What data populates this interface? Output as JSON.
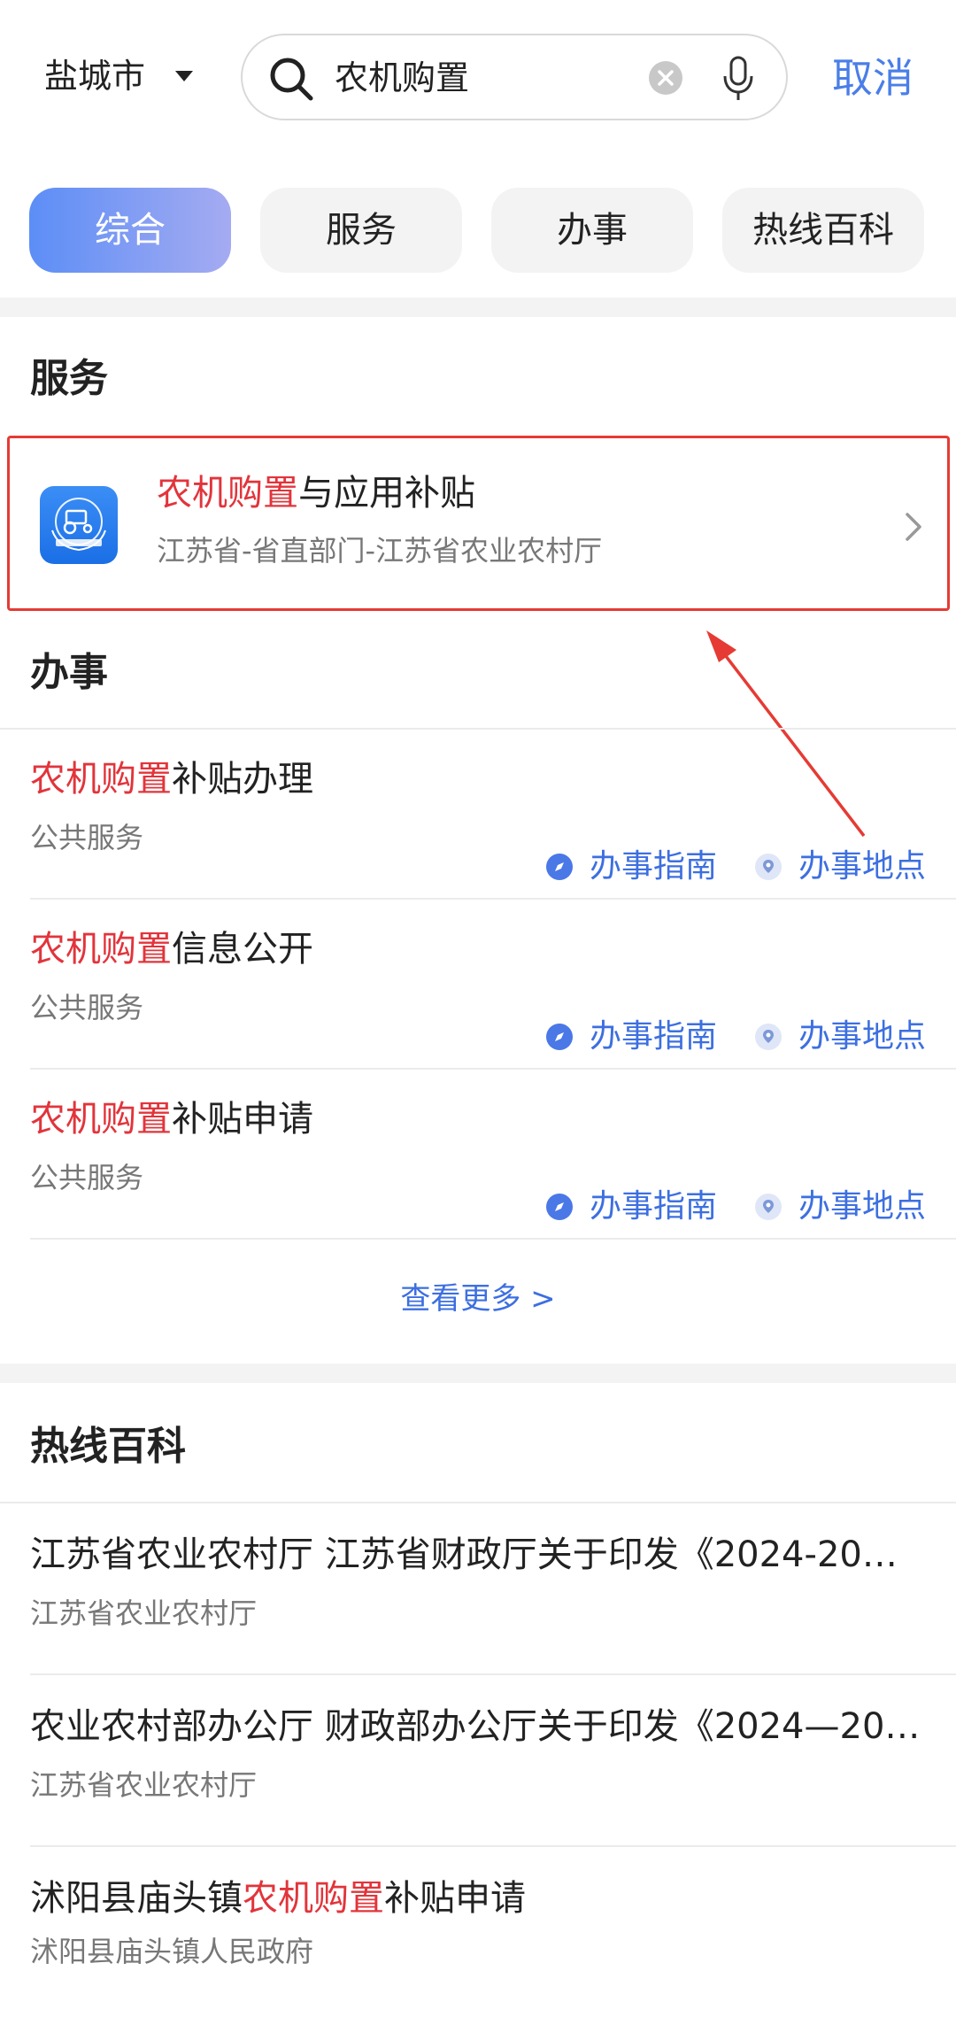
{
  "topbar": {
    "city": "盐城市",
    "search_value": "农机购置",
    "cancel_label": "取消"
  },
  "tabs": [
    {
      "label": "综合",
      "active": true
    },
    {
      "label": "服务",
      "active": false
    },
    {
      "label": "办事",
      "active": false
    },
    {
      "label": "热线百科",
      "active": false
    }
  ],
  "service": {
    "section_title": "服务",
    "item": {
      "title_highlight": "农机购置",
      "title_rest": "与应用补贴",
      "subtitle": "江苏省-省直部门-江苏省农业农村厅"
    }
  },
  "affairs": {
    "section_title": "办事",
    "guide_label": "办事指南",
    "place_label": "办事地点",
    "items": [
      {
        "highlight": "农机购置",
        "rest": "补贴办理",
        "category": "公共服务"
      },
      {
        "highlight": "农机购置",
        "rest": "信息公开",
        "category": "公共服务"
      },
      {
        "highlight": "农机购置",
        "rest": "补贴申请",
        "category": "公共服务"
      }
    ],
    "more_label": "查看更多  >"
  },
  "hotline": {
    "section_title": "热线百科",
    "items": [
      {
        "prefix": "江苏省农业农村厅 江苏省财政厅关于印发《2024-20…",
        "highlight": "",
        "suffix": "",
        "source": "江苏省农业农村厅"
      },
      {
        "prefix": "农业农村部办公厅  财政部办公厅关于印发《2024—20…",
        "highlight": "",
        "suffix": "",
        "source": "江苏省农业农村厅"
      },
      {
        "prefix": "沭阳县庙头镇",
        "highlight": "农机购置",
        "suffix": "补贴申请",
        "source": "沭阳县庙头镇人民政府"
      }
    ]
  },
  "colors": {
    "accent": "#4a7ee8",
    "highlight": "#e2343b",
    "annotation": "#e53b34"
  }
}
